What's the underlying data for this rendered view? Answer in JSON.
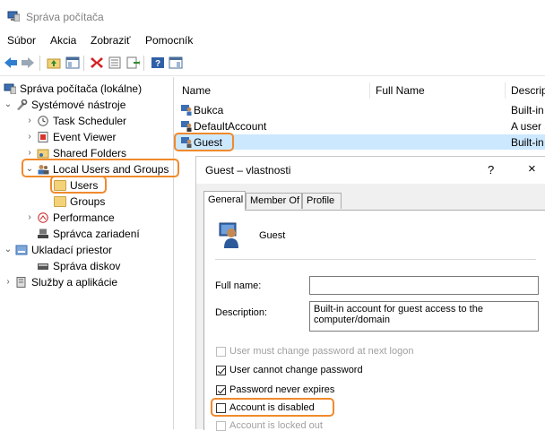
{
  "app": {
    "title": "Správa počítača"
  },
  "menu": [
    "Súbor",
    "Akcia",
    "Zobraziť",
    "Pomocník"
  ],
  "tree": {
    "root": "Správa počítača (lokálne)",
    "system_tools": "Systémové nástroje",
    "task_scheduler": "Task Scheduler",
    "event_viewer": "Event Viewer",
    "shared_folders": "Shared Folders",
    "local_users": "Local Users and Groups",
    "users": "Users",
    "groups": "Groups",
    "performance": "Performance",
    "device_manager": "Správca zariadení",
    "storage": "Ukladací priestor",
    "disk_management": "Správa diskov",
    "services": "Služby a aplikácie"
  },
  "list": {
    "columns": [
      "Name",
      "Full Name",
      "Descrip"
    ],
    "rows": [
      {
        "name": "Bukca",
        "full_name": "",
        "description": "Built-in"
      },
      {
        "name": "DefaultAccount",
        "full_name": "",
        "description": "A user a"
      },
      {
        "name": "Guest",
        "full_name": "",
        "description": "Built-in"
      }
    ]
  },
  "dialog": {
    "title": "Guest – vlastnosti",
    "help": "?",
    "close": "×",
    "tabs": [
      "General",
      "Member Of",
      "Profile"
    ],
    "username": "Guest",
    "full_name_label": "Full name:",
    "full_name_value": "",
    "description_label": "Description:",
    "description_value": "Built-in account for guest access to the computer/domain",
    "checkboxes": {
      "must_change": {
        "label": "User must change password at next logon",
        "checked": false,
        "disabled": true
      },
      "cannot_change": {
        "label": "User cannot change password",
        "checked": true,
        "disabled": false
      },
      "never_expires": {
        "label": "Password never expires",
        "checked": true,
        "disabled": false
      },
      "disabled": {
        "label": "Account is disabled",
        "checked": false,
        "disabled": false
      },
      "locked_out": {
        "label": "Account is locked out",
        "checked": false,
        "disabled": true
      }
    }
  },
  "colors": {
    "highlight": "#f08a2c",
    "selection": "#cce8ff"
  }
}
